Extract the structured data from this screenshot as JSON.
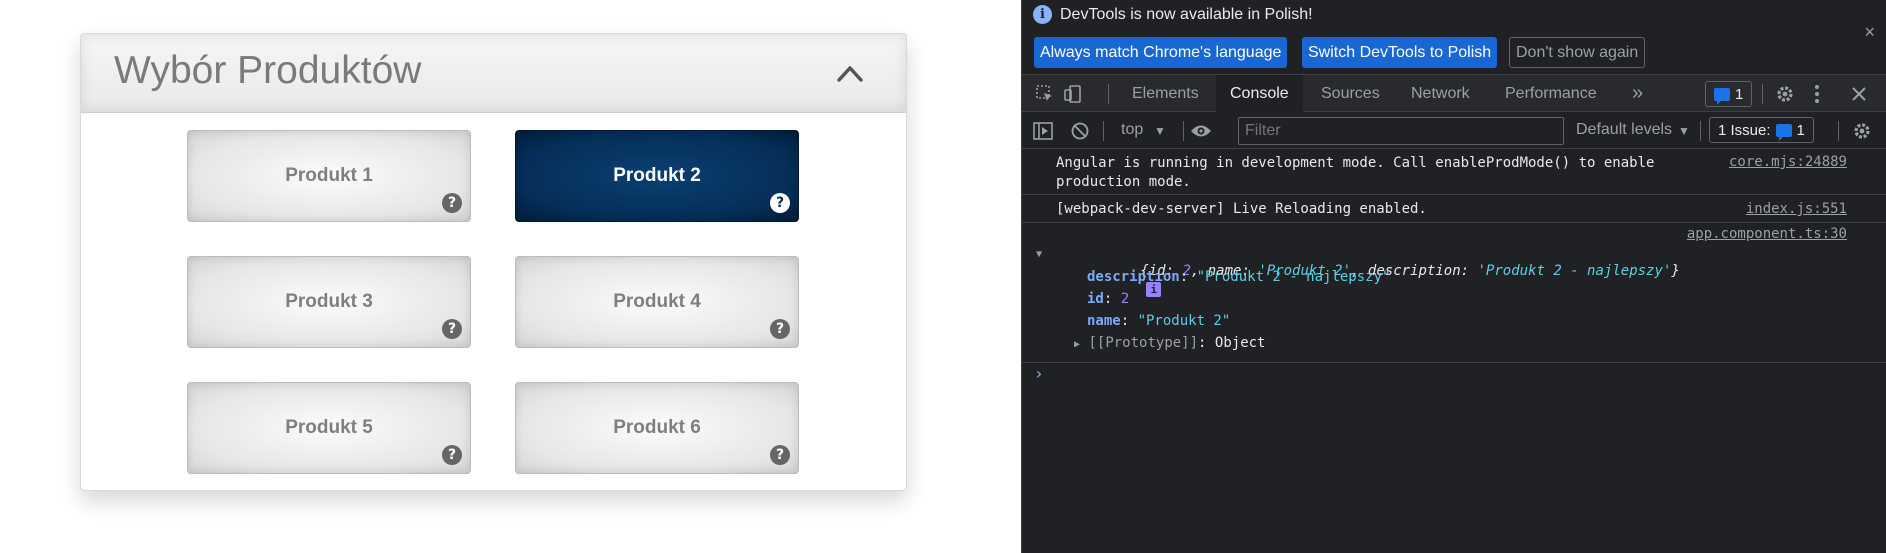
{
  "app": {
    "panel_title": "Wybór Produktów",
    "products": [
      {
        "label": "Produkt 1",
        "selected": false
      },
      {
        "label": "Produkt 2",
        "selected": true
      },
      {
        "label": "Produkt 3",
        "selected": false
      },
      {
        "label": "Produkt 4",
        "selected": false
      },
      {
        "label": "Produkt 5",
        "selected": false
      },
      {
        "label": "Produkt 6",
        "selected": false
      }
    ],
    "help_glyph": "?",
    "colors": {
      "selected_tile": "#052e57",
      "title_text": "#7a7a7a",
      "tile_text": "#7f7f7f"
    }
  },
  "devtools": {
    "banner": {
      "message": "DevTools is now available in Polish!",
      "match_language": "Always match Chrome's language",
      "switch_language": "Switch DevTools to Polish",
      "dont_show": "Don't show again",
      "close": "×"
    },
    "tabs": [
      "Elements",
      "Console",
      "Sources",
      "Network",
      "Performance"
    ],
    "active_tab": "Console",
    "more_tabs": "»",
    "message_count": "1",
    "toolbar": {
      "context": "top",
      "filter_placeholder": "Filter",
      "levels": "Default levels",
      "issues_label": "1 Issue:",
      "issues_count": "1"
    },
    "console": {
      "line1_msg": "Angular is running in development mode. Call enableProdMode() to enable\nproduction mode.",
      "line1_src": "core.mjs:24889",
      "line2_msg": "[webpack-dev-server] Live Reloading enabled.",
      "line2_src": "index.js:551",
      "line3_src": "app.component.ts:30",
      "obj_summary": {
        "open": "{",
        "id_key": "id",
        "id_val": "2",
        "name_key": "name",
        "name_val": "'Produkt 2'",
        "desc_key": "description",
        "desc_val": "'Produkt 2 - najlepszy'",
        "close": "}"
      },
      "props": [
        {
          "key": "description",
          "value": "\"Produkt 2 - najlepszy\""
        },
        {
          "key": "id",
          "value": "2"
        },
        {
          "key": "name",
          "value": "\"Produkt 2\""
        }
      ],
      "prototype_key": "[[Prototype]]",
      "prototype_val": "Object",
      "prompt": "›"
    },
    "colors": {
      "background": "#202124",
      "primary_button": "#1967d2",
      "link": "#9aa0a6"
    }
  }
}
